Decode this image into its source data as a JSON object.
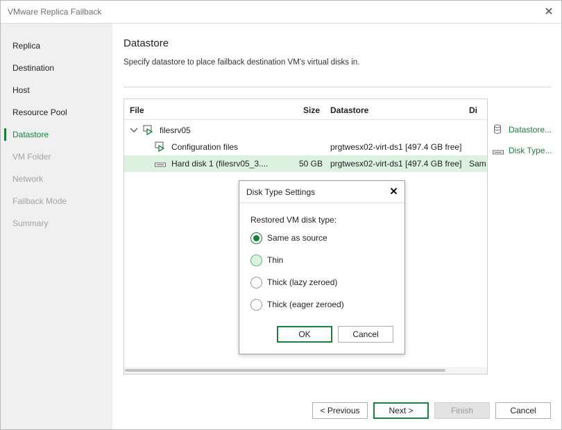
{
  "window": {
    "title": "VMware Replica Failback"
  },
  "sidebar": {
    "steps": [
      {
        "label": "Replica"
      },
      {
        "label": "Destination"
      },
      {
        "label": "Host"
      },
      {
        "label": "Resource Pool"
      },
      {
        "label": "Datastore"
      },
      {
        "label": "VM Folder"
      },
      {
        "label": "Network"
      },
      {
        "label": "Failback Mode"
      },
      {
        "label": "Summary"
      }
    ],
    "active": "Datastore"
  },
  "page": {
    "heading": "Datastore",
    "subheading": "Specify datastore to place failback destination VM's virtual disks in."
  },
  "grid": {
    "columns": {
      "file": "File",
      "size": "Size",
      "datastore": "Datastore",
      "disk_type": "Di"
    },
    "rows": [
      {
        "file": "filesrv05",
        "size": "",
        "datastore": "",
        "disk_type": ""
      },
      {
        "file": "Configuration files",
        "size": "",
        "datastore": "prgtwesx02-virt-ds1 [497.4 GB free]",
        "disk_type": ""
      },
      {
        "file": "Hard disk 1 (filesrv05_3....",
        "size": "50 GB",
        "datastore": "prgtwesx02-virt-ds1 [497.4 GB free]",
        "disk_type": "Sam"
      }
    ]
  },
  "actions": {
    "datastore": "Datastore...",
    "disk_type": "Disk Type..."
  },
  "footer": {
    "previous": "< Previous",
    "next": "Next >",
    "finish": "Finish",
    "cancel": "Cancel"
  },
  "dialog": {
    "title": "Disk Type Settings",
    "label": "Restored VM disk type:",
    "options": [
      {
        "label": "Same as source"
      },
      {
        "label": "Thin"
      },
      {
        "label": "Thick (lazy zeroed)"
      },
      {
        "label": "Thick (eager zeroed)"
      }
    ],
    "selected": "Same as source",
    "ok": "OK",
    "cancel": "Cancel"
  },
  "colors": {
    "accent": "#1a7f3c",
    "selected_row": "#ddf1e1",
    "sidebar_bg": "#f0f0f0"
  }
}
